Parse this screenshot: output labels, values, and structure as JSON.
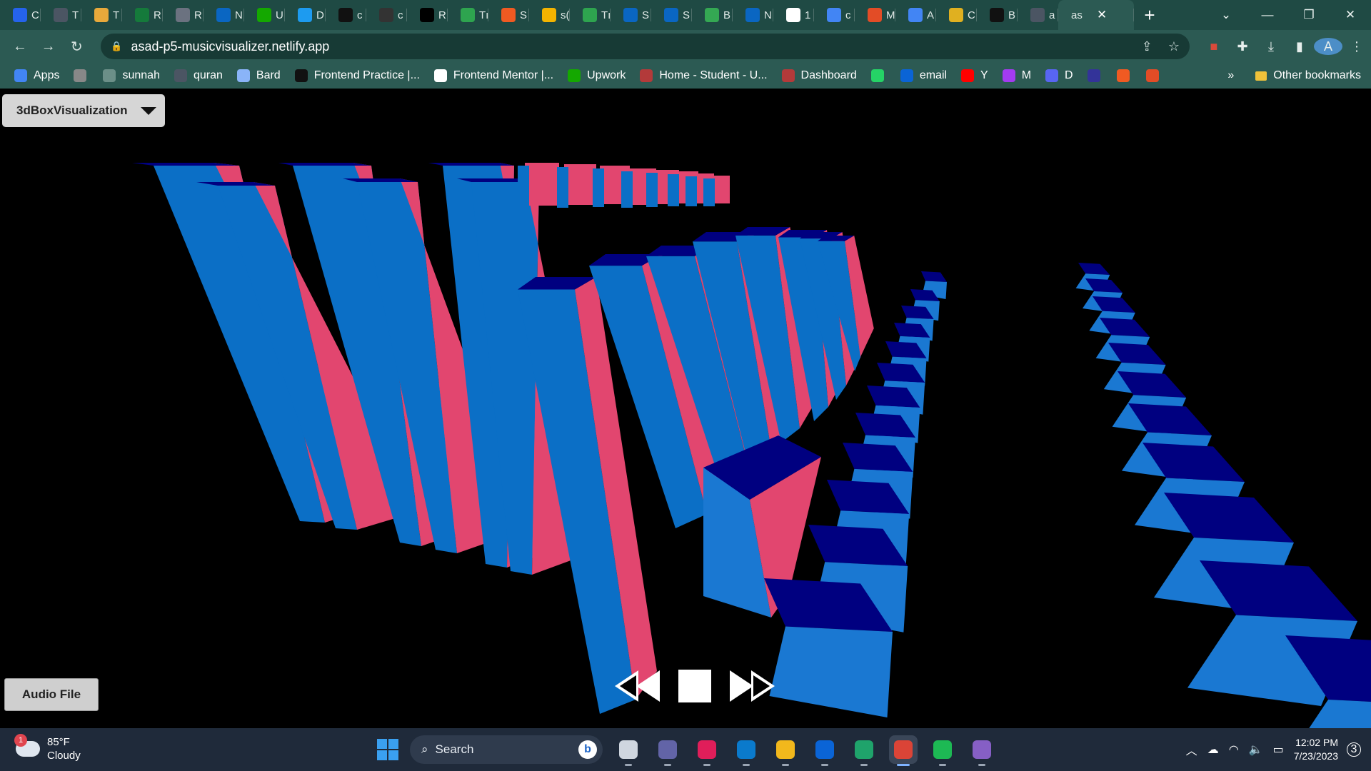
{
  "browser": {
    "tabs": [
      {
        "title": "C",
        "icon": "c-logo-icon",
        "color": "#2563eb"
      },
      {
        "title": "T",
        "icon": "globe-icon",
        "color": "#4b5563"
      },
      {
        "title": "T",
        "icon": "chrome-like-icon",
        "color": "#e8a93b"
      },
      {
        "title": "R",
        "icon": "w-logo-icon",
        "color": "#157a3b"
      },
      {
        "title": "R",
        "icon": "openai-icon",
        "color": "#6b7280"
      },
      {
        "title": "N",
        "icon": "linkedin-icon",
        "color": "#0a66c2"
      },
      {
        "title": "U",
        "icon": "upwork-icon",
        "color": "#14a800"
      },
      {
        "title": "D",
        "icon": "bird-icon",
        "color": "#1d9bf0"
      },
      {
        "title": "c",
        "icon": "github-icon",
        "color": "#111111"
      },
      {
        "title": "c",
        "icon": "square-icon",
        "color": "#333333"
      },
      {
        "title": "R",
        "icon": "square-dark-icon",
        "color": "#000000"
      },
      {
        "title": "Tı",
        "icon": "px-icon",
        "color": "#2ea44f"
      },
      {
        "title": "S",
        "icon": "flame-icon",
        "color": "#f05a22"
      },
      {
        "title": "s(",
        "icon": "drive-icon",
        "color": "#f4b400"
      },
      {
        "title": "Tı",
        "icon": "px-icon",
        "color": "#2ea44f"
      },
      {
        "title": "S",
        "icon": "linkedin-icon",
        "color": "#0a66c2"
      },
      {
        "title": "S",
        "icon": "linkedin-icon",
        "color": "#0a66c2"
      },
      {
        "title": "B",
        "icon": "green-circle-icon",
        "color": "#34a853"
      },
      {
        "title": "N",
        "icon": "linkedin-icon",
        "color": "#0a66c2"
      },
      {
        "title": "1",
        "icon": "google-icon",
        "color": "#ffffff"
      },
      {
        "title": "c",
        "icon": "docs-icon",
        "color": "#4285f4"
      },
      {
        "title": "M",
        "icon": "pinwheel-icon",
        "color": "#e34c26"
      },
      {
        "title": "A",
        "icon": "docs-icon",
        "color": "#4285f4"
      },
      {
        "title": "C",
        "icon": "yellow-square-icon",
        "color": "#e0b020"
      },
      {
        "title": "B",
        "icon": "dark-square-icon",
        "color": "#111111"
      },
      {
        "title": "a",
        "icon": "globe-icon",
        "color": "#4b5563"
      },
      {
        "title": "as",
        "icon": "",
        "color": "",
        "active": true
      }
    ],
    "new_tab": "+",
    "url": "asad-p5-musicvisualizer.netlify.app"
  },
  "bookmarks": [
    {
      "label": "Apps",
      "icon": "apps-grid-icon",
      "color": "#4285f4"
    },
    {
      "label": "",
      "icon": "image-icon",
      "color": "#888888"
    },
    {
      "label": "sunnah",
      "icon": "flower-icon",
      "color": "#6b8f88"
    },
    {
      "label": "quran",
      "icon": "globe-icon",
      "color": "#4b5563"
    },
    {
      "label": "Bard",
      "icon": "sparkle-icon",
      "color": "#8ab4f8"
    },
    {
      "label": "Frontend Practice |...",
      "icon": "fp-icon",
      "color": "#111111"
    },
    {
      "label": "Frontend Mentor |...",
      "icon": "fm-icon",
      "color": "#ffffff"
    },
    {
      "label": "Upwork",
      "icon": "upwork-icon",
      "color": "#14a800"
    },
    {
      "label": "Home - Student - U...",
      "icon": "crest-icon",
      "color": "#b33a3a"
    },
    {
      "label": "Dashboard",
      "icon": "crest-icon",
      "color": "#b33a3a"
    },
    {
      "label": "",
      "icon": "whatsapp-icon",
      "color": "#25d366"
    },
    {
      "label": "email",
      "icon": "outlook-icon",
      "color": "#0a64d6"
    },
    {
      "label": "Y",
      "icon": "youtube-icon",
      "color": "#ff0000"
    },
    {
      "label": "M",
      "icon": "messenger-icon",
      "color": "#a33bf0"
    },
    {
      "label": "D",
      "icon": "discord-icon",
      "color": "#5865f2"
    },
    {
      "label": "",
      "icon": "dark-tile-icon",
      "color": "#333399"
    },
    {
      "label": "",
      "icon": "flame-icon",
      "color": "#f05a22"
    },
    {
      "label": "",
      "icon": "pinwheel-icon",
      "color": "#e34c26"
    }
  ],
  "bookmarks_more": "»",
  "other_bookmarks": "Other bookmarks",
  "app": {
    "mode_selector": "3dBoxVisualization",
    "audio_button": "Audio File",
    "colors": {
      "pink": "#e2466f",
      "blue": "#0b6fc6",
      "navy": "#000080",
      "lightblue": "#1a78d2"
    }
  },
  "taskbar": {
    "badge": "1",
    "temperature": "85°F",
    "condition": "Cloudy",
    "search": "Search",
    "time": "12:02 PM",
    "date": "7/23/2023",
    "notifications": "3",
    "apps": [
      {
        "name": "task-view-icon",
        "color": "#cfd6df"
      },
      {
        "name": "teams-chat-icon",
        "color": "#6264a7"
      },
      {
        "name": "slack-icon",
        "color": "#e01e5a"
      },
      {
        "name": "vscode-icon",
        "color": "#0a7acc"
      },
      {
        "name": "file-explorer-icon",
        "color": "#f2b81c"
      },
      {
        "name": "mail-icon",
        "color": "#0a64d6"
      },
      {
        "name": "edge-icon",
        "color": "#1fa36b"
      },
      {
        "name": "chrome-icon",
        "color": "#db4437",
        "active": true
      },
      {
        "name": "spotify-icon",
        "color": "#1db954"
      },
      {
        "name": "visual-studio-icon",
        "color": "#865fc5"
      }
    ]
  }
}
